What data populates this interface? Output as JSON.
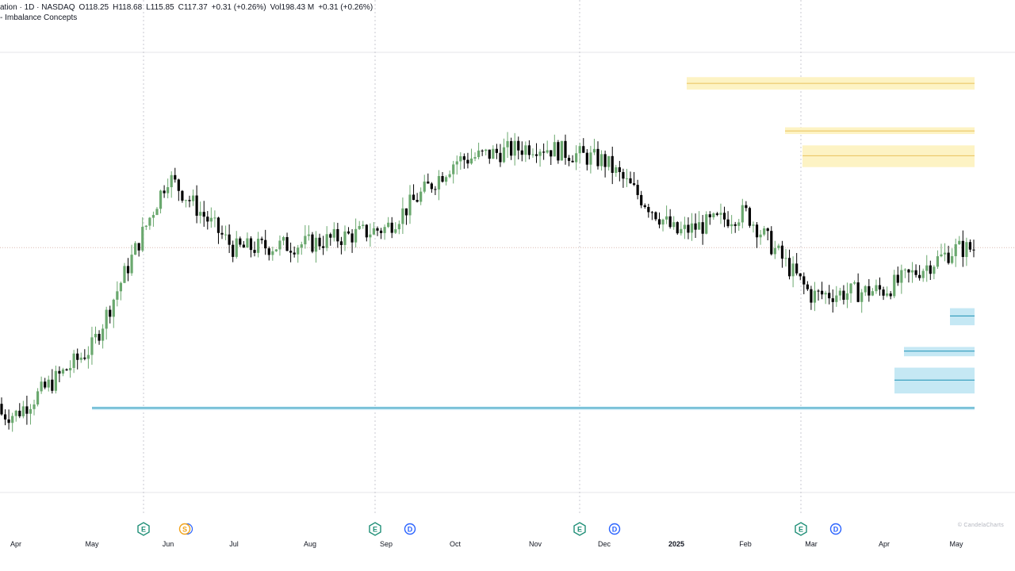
{
  "header": {
    "title": "ation · 1D · NASDAQ",
    "open": "O118.25",
    "high": "H118.68",
    "low": "L115.85",
    "close": "C117.37",
    "change": "+0.31 (+0.26%)",
    "volume": "Vol198.43 M",
    "volume_change": "+0.31 (+0.26%)",
    "indicator": "- Imbalance Concepts"
  },
  "watermark": "© CandelaCharts",
  "colors": {
    "up": "#6aa86e",
    "down": "#000000",
    "supply_zone": "#fdf3c4",
    "supply_line": "#e8c15a",
    "demand_zone": "#c5e8f4",
    "demand_line": "#1b8fb3",
    "grid": "#c8c8d0"
  },
  "events": [
    {
      "label": "E",
      "type": "earnings",
      "month_index": 2
    },
    {
      "label": "S",
      "type": "split",
      "month_index": 2
    },
    {
      "label": "E",
      "type": "earnings",
      "month_index": 5
    },
    {
      "label": "D",
      "type": "dividend",
      "month_index": 5
    },
    {
      "label": "E",
      "type": "earnings",
      "month_index": 8
    },
    {
      "label": "D",
      "type": "dividend",
      "month_index": 8
    },
    {
      "label": "E",
      "type": "earnings",
      "month_index": 11
    },
    {
      "label": "D",
      "type": "dividend",
      "month_index": 11
    }
  ],
  "chart_data": {
    "type": "candlestick",
    "x_tick_labels": [
      "Apr",
      "May",
      "Jun",
      "Jul",
      "Aug",
      "Sep",
      "Oct",
      "Nov",
      "Dec",
      "2025",
      "Feb",
      "Mar",
      "Apr",
      "May"
    ],
    "grid": "vertical dotted separators",
    "price_range_approx": [
      70,
      155
    ],
    "last_price": 117.37,
    "monthly_closes_approx": [
      {
        "month": "Apr",
        "close": 85
      },
      {
        "month": "May",
        "close": 98
      },
      {
        "month": "Jun",
        "close": 131
      },
      {
        "month": "Jul",
        "close": 117
      },
      {
        "month": "Aug",
        "close": 118
      },
      {
        "month": "Sep",
        "close": 121
      },
      {
        "month": "Oct",
        "close": 134
      },
      {
        "month": "Nov",
        "close": 137
      },
      {
        "month": "Dec",
        "close": 134
      },
      {
        "month": "2025",
        "close": 120
      },
      {
        "month": "Feb",
        "close": 124
      },
      {
        "month": "Mar",
        "close": 108
      },
      {
        "month": "Apr",
        "close": 109
      },
      {
        "month": "May",
        "close": 117
      }
    ],
    "supply_zones": [
      {
        "top": 150.2,
        "bottom": 147.8,
        "mid": 149.0
      },
      {
        "top": 140.5,
        "bottom": 139.2,
        "mid": 139.8
      },
      {
        "top": 137.0,
        "bottom": 132.8,
        "mid": 135.0
      }
    ],
    "demand_zones": [
      {
        "top": 105.5,
        "bottom": 102.2,
        "mid": 104.0
      },
      {
        "top": 98.0,
        "bottom": 96.2,
        "mid": 97.2
      },
      {
        "top": 94.0,
        "bottom": 89.0,
        "mid": 91.6
      },
      {
        "top": 86.5,
        "bottom": 85.8,
        "mid": 86.2
      }
    ]
  }
}
